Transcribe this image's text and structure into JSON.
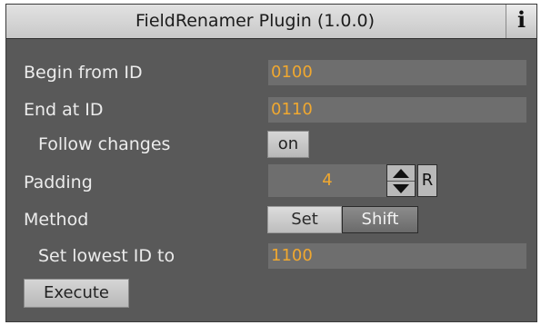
{
  "title": "FieldRenamer Plugin (1.0.0)",
  "info_button": {
    "icon": "info-icon",
    "label": "i"
  },
  "rows": {
    "begin_from_id": {
      "label": "Begin from ID",
      "value": "0100"
    },
    "end_at_id": {
      "label": "End at ID",
      "value": "0110"
    },
    "follow_changes": {
      "label": "Follow changes",
      "toggle": "on"
    },
    "padding": {
      "label": "Padding",
      "value": "4",
      "reset_label": "R"
    },
    "method": {
      "label": "Method",
      "options": [
        "Set",
        "Shift"
      ],
      "selected": "Set"
    },
    "set_lowest_id": {
      "label": "Set lowest ID to",
      "value": "1100"
    }
  },
  "execute_label": "Execute",
  "colors": {
    "panel": "#595959",
    "field": "#6e6e6e",
    "value_text": "#f0a830",
    "label_text": "#ececec"
  }
}
